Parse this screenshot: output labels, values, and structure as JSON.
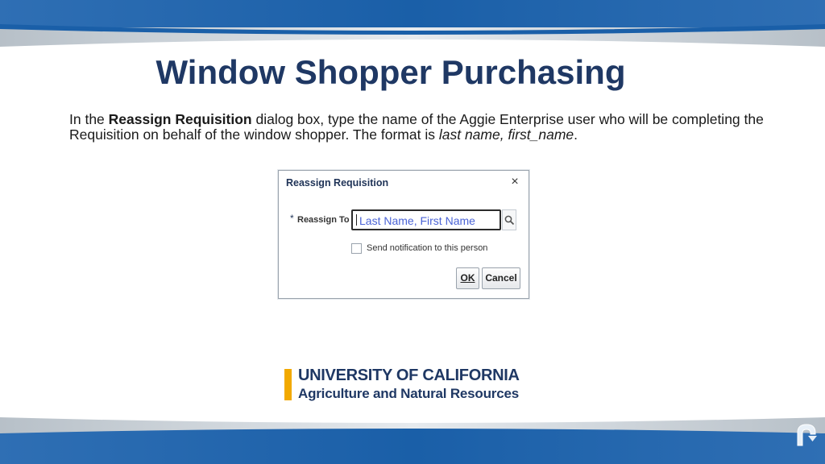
{
  "slide": {
    "title": "Window Shopper Purchasing",
    "instructions": {
      "part1": "In the ",
      "bold": "Reassign Requisition",
      "part2": " dialog box, type the name of the Aggie Enterprise user who will be completing the Requisition on behalf of the window shopper.  The format is ",
      "italic": "last name, first_name",
      "part3": "."
    }
  },
  "dialog": {
    "title": "Reassign Requisition",
    "close_glyph": "×",
    "required_marker": "*",
    "field_label": "Reassign To",
    "field_placeholder": "Last Name, First Name",
    "field_value": "",
    "checkbox_label": "Send notification to this person",
    "checkbox_checked": false,
    "ok_label": "OK",
    "cancel_label": "Cancel"
  },
  "logo": {
    "line1": "UNIVERSITY OF CALIFORNIA",
    "line2": "Agriculture and Natural Resources"
  },
  "icons": {
    "search": "search-icon",
    "close": "close-icon",
    "corner": "logo-mark-icon"
  },
  "colors": {
    "title": "#1f3864",
    "band_blue": "#1a5fa8",
    "logo_gold": "#f2a900",
    "placeholder_blue": "#4a63d6"
  }
}
